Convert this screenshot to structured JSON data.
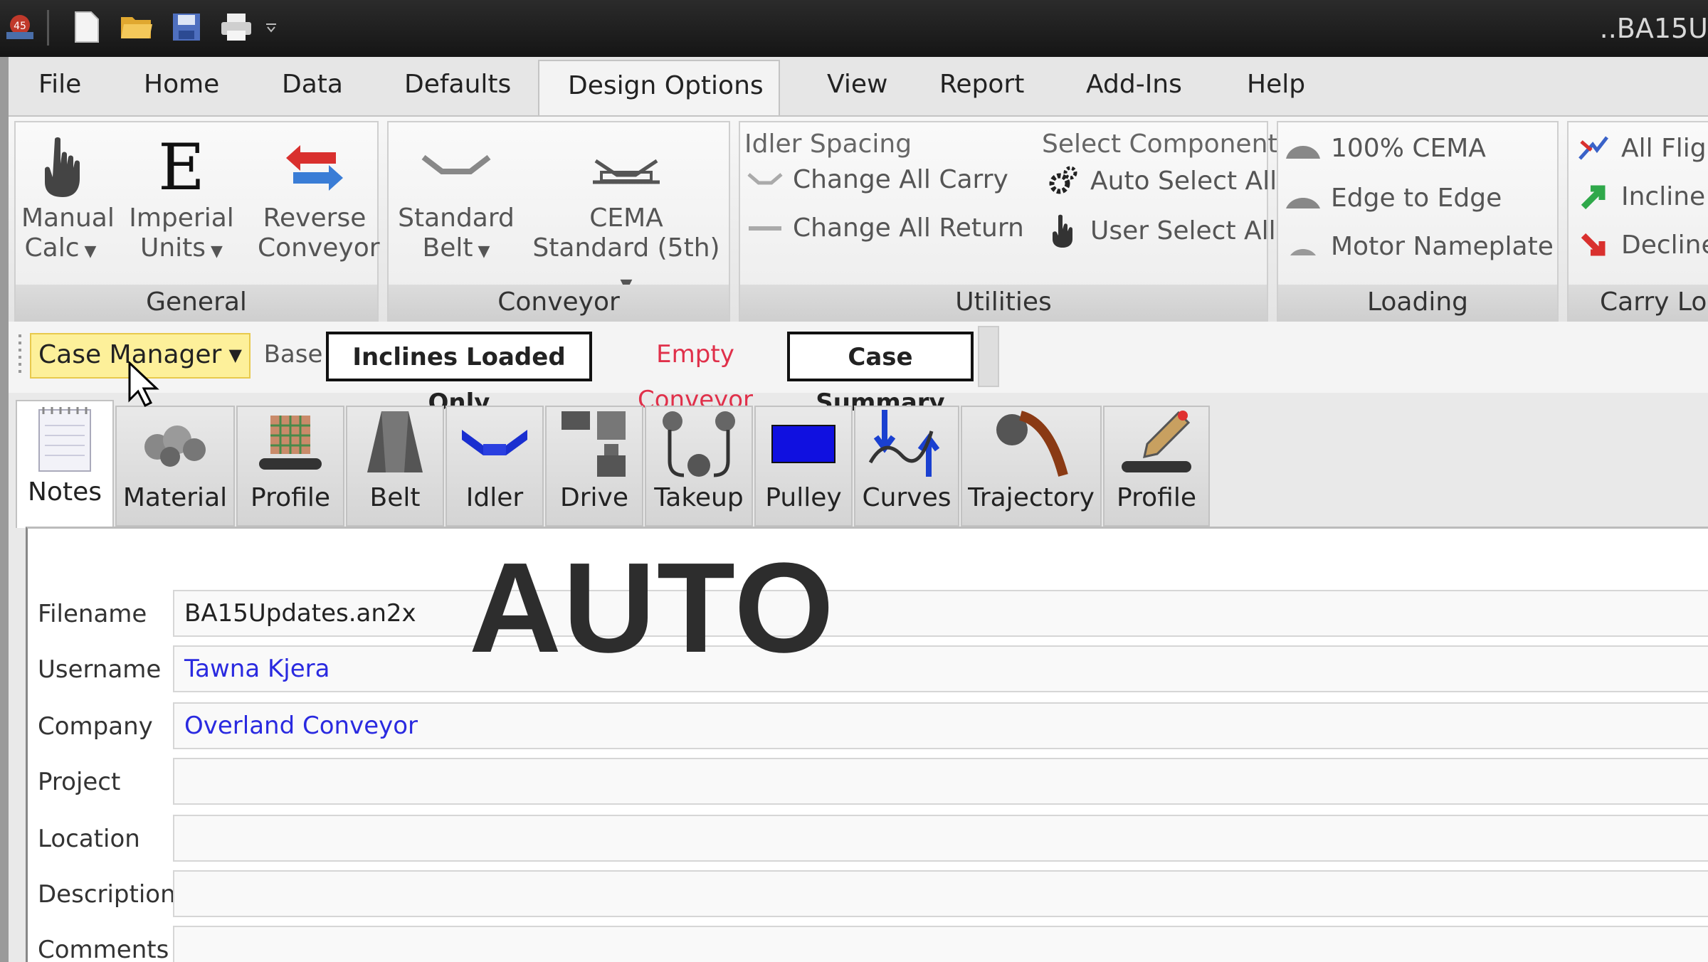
{
  "window": {
    "title": "..BA15U"
  },
  "quick_access": [
    "app-logo-icon",
    "new-file-icon",
    "open-folder-icon",
    "save-icon",
    "print-icon",
    "customize-dropdown-icon"
  ],
  "ribbon_tabs": [
    "File",
    "Home",
    "Data",
    "Defaults",
    "Design Options",
    "View",
    "Report",
    "Add-Ins",
    "Help"
  ],
  "active_tab": "Design Options",
  "groups": {
    "general": {
      "label": "General",
      "manual_calc": [
        "Manual",
        "Calc"
      ],
      "imperial_units": [
        "Imperial",
        "Units"
      ],
      "reverse_conveyor": [
        "Reverse",
        "Conveyor"
      ]
    },
    "conveyor": {
      "label": "Conveyor",
      "standard_belt": [
        "Standard",
        "Belt"
      ],
      "cema_standard": [
        "CEMA",
        "Standard (5th)"
      ]
    },
    "utilities": {
      "label": "Utilities",
      "idler_spacing": "Idler Spacing",
      "change_all_carry": "Change All Carry",
      "change_all_return": "Change All Return",
      "select_components": "Select Components",
      "auto_select_all": "Auto Select All",
      "user_select_all": "User Select All"
    },
    "loading": {
      "label": "Loading",
      "cema_100": "100% CEMA",
      "edge_to_edge": "Edge to Edge",
      "motor_nameplate": "Motor Nameplate"
    },
    "carry_load": {
      "label": "Carry Loa",
      "all_flights": "All Flig",
      "inclines": "Incline",
      "declines": "Decline"
    }
  },
  "case_bar": {
    "case_manager": "Case Manager",
    "base": "Base",
    "inclines_loaded_only": "Inclines Loaded Only",
    "empty_conveyor": "Empty Conveyor",
    "case_summary": "Case Summary"
  },
  "page_tabs": [
    "Notes",
    "Material",
    "Profile",
    "Belt",
    "Idler",
    "Drive",
    "Takeup",
    "Pulley",
    "Curves",
    "Trajectory",
    "Profile"
  ],
  "active_page_tab": "Notes",
  "form": {
    "filename_label": "Filename",
    "filename_value": "BA15Updates.an2x",
    "username_label": "Username",
    "username_value": "Tawna Kjera",
    "company_label": "Company",
    "company_value": "Overland Conveyor",
    "project_label": "Project",
    "project_value": "",
    "location_label": "Location",
    "location_value": "",
    "description_label": "Description",
    "description_value": "",
    "comments_label": "Comments",
    "comments_value": ""
  },
  "overlay_text": "AUTO",
  "colors": {
    "case_manager_bg": "#fdf09a",
    "empty_conveyor_text": "#e0304a",
    "link_blue": "#2a2ae0"
  }
}
